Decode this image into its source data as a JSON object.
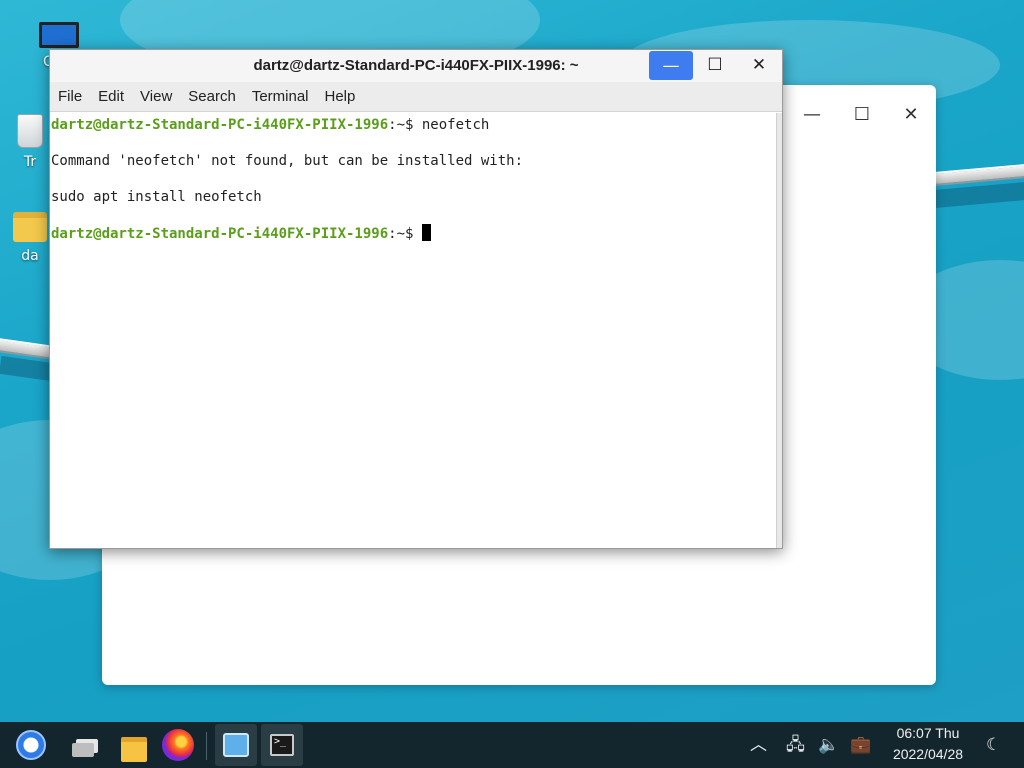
{
  "desktop": {
    "icons": [
      {
        "label": "Com",
        "icon": "computer-icon"
      },
      {
        "label": "Tr",
        "icon": "trash-icon"
      },
      {
        "label": "da",
        "icon": "home-folder-icon"
      }
    ]
  },
  "terminal": {
    "title": "dartz@dartz-Standard-PC-i440FX-PIIX-1996: ~",
    "menu": [
      "File",
      "Edit",
      "View",
      "Search",
      "Terminal",
      "Help"
    ],
    "lines": [
      {
        "user": "dartz@dartz-Standard-PC-i440FX-PIIX-1996",
        "path": ":~$ ",
        "cmd": "neofetch"
      },
      {
        "text": "Command 'neofetch' not found, but can be installed with:"
      },
      {
        "text": "sudo apt install neofetch"
      },
      {
        "user": "dartz@dartz-Standard-PC-i440FX-PIIX-1996",
        "path": ":~$ ",
        "cmd": ""
      }
    ],
    "controls": {
      "minimize": "—",
      "maximize": "☐",
      "close": "✕"
    }
  },
  "background_window": {
    "controls": {
      "minimize": "—",
      "maximize": "☐",
      "close": "✕"
    }
  },
  "taskbar": {
    "apps": [
      "start-menu-icon",
      "show-desktop-icon",
      "file-manager-icon",
      "firefox-icon",
      "control-panel-icon",
      "terminal-icon"
    ],
    "tray": {
      "network": "network-icon",
      "volume": "volume-icon",
      "bag": "briefcase-icon",
      "night": "moon-icon"
    },
    "clock": {
      "time": "06:07 Thu",
      "date": "2022/04/28"
    }
  },
  "colors": {
    "prompt_user": "#5a9e1a",
    "minimize_active": "#3e7cf0",
    "taskbar": "#14262d"
  }
}
